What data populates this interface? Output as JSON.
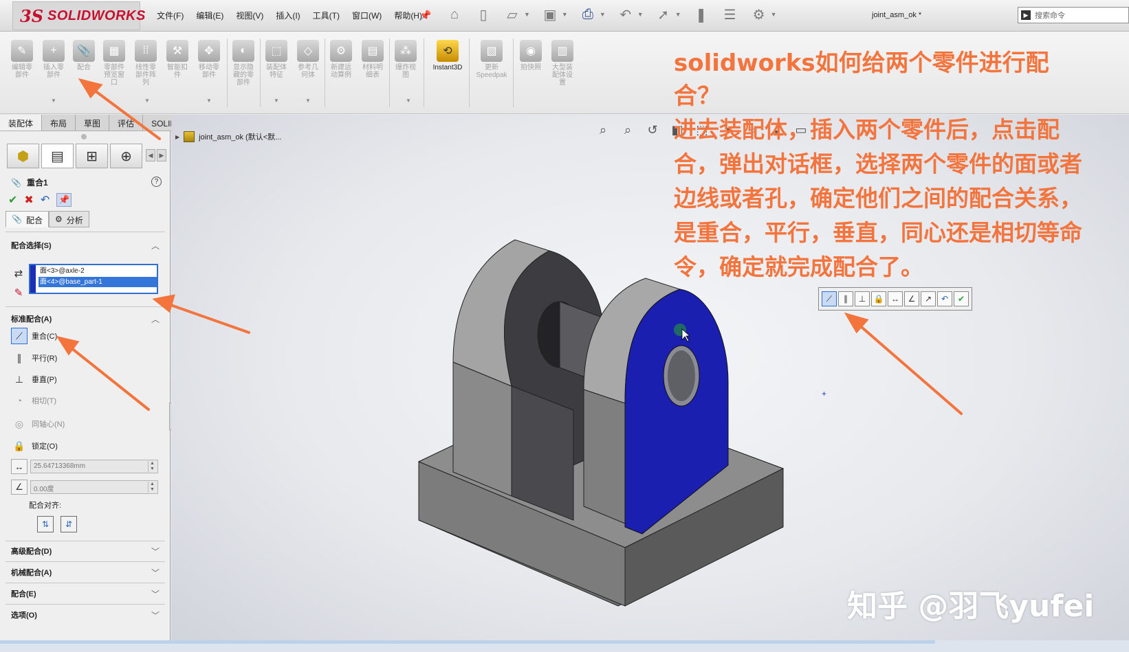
{
  "app": {
    "logo_mark": "3S",
    "logo_text": "SOLIDWORKS",
    "document_title": "joint_asm_ok *",
    "search_placeholder": "搜索命令"
  },
  "menu": [
    "文件(F)",
    "编辑(E)",
    "视图(V)",
    "插入(I)",
    "工具(T)",
    "窗口(W)",
    "帮助(H)"
  ],
  "ribbon": [
    {
      "label": "编辑零\n部件",
      "icon": "edit-component-icon"
    },
    {
      "label": "插入零\n部件",
      "icon": "insert-component-icon"
    },
    {
      "label": "配合",
      "icon": "mate-icon"
    },
    {
      "label": "零部件\n预览窗\n口",
      "icon": "component-preview-icon"
    },
    {
      "label": "线性零\n部件阵\n列",
      "icon": "linear-pattern-icon"
    },
    {
      "label": "智能扣\n件",
      "icon": "smart-fasteners-icon"
    },
    {
      "label": "移动零\n部件",
      "icon": "move-component-icon"
    },
    {
      "label": "显示隐\n藏的零\n部件",
      "icon": "show-hidden-icon"
    },
    {
      "label": "装配体\n特征",
      "icon": "assembly-features-icon"
    },
    {
      "label": "参考几\n何体",
      "icon": "reference-geometry-icon"
    },
    {
      "label": "新建运\n动算例",
      "icon": "new-motion-study-icon"
    },
    {
      "label": "材料明\n细表",
      "icon": "bom-icon"
    },
    {
      "label": "爆炸视\n图",
      "icon": "exploded-view-icon"
    },
    {
      "label": "Instant3D",
      "icon": "instant3d-icon"
    },
    {
      "label": "更新\nSpeedpak",
      "icon": "speedpak-icon"
    },
    {
      "label": "拍快照",
      "icon": "snapshot-icon"
    },
    {
      "label": "大型装\n配体设\n置",
      "icon": "large-assembly-icon"
    }
  ],
  "tabs": [
    "装配体",
    "布局",
    "草图",
    "评估",
    "SOLIDWORKS 插件"
  ],
  "property_manager": {
    "title": "重合1",
    "help": "?",
    "subtab_mates": "配合",
    "subtab_analysis": "分析",
    "section_mate_selections": "配合选择(S)",
    "selections": [
      "面<3>@axle-2",
      "面<4>@base_part-1"
    ],
    "section_standard": "标准配合(A)",
    "standard_mates": [
      {
        "label": "重合(C)",
        "icon": "coincident-icon",
        "state": "active"
      },
      {
        "label": "平行(R)",
        "icon": "parallel-icon",
        "state": "enabled"
      },
      {
        "label": "垂直(P)",
        "icon": "perpendicular-icon",
        "state": "enabled"
      },
      {
        "label": "相切(T)",
        "icon": "tangent-icon",
        "state": "disabled"
      },
      {
        "label": "同轴心(N)",
        "icon": "concentric-icon",
        "state": "disabled"
      },
      {
        "label": "锁定(O)",
        "icon": "lock-icon",
        "state": "enabled"
      }
    ],
    "distance_value": "25.64713368mm",
    "angle_value": "0.00度",
    "mate_alignment_label": "配合对齐:",
    "section_advanced": "高级配合(D)",
    "section_mechanical": "机械配合(A)",
    "section_mates": "配合(E)",
    "section_options": "选项(O)"
  },
  "viewport": {
    "tree_root": "joint_asm_ok  (默认<默..."
  },
  "annotation": {
    "title": "solidworks如何给两个零件进行配合？",
    "body": "进去装配体，插入两个零件后，点击配合，弹出对话框，选择两个零件的面或者边线或者孔，确定他们之间的配合关系，是重合，平行，垂直，同心还是相切等命令，确定就完成配合了。"
  },
  "watermark": "知乎 @羽飞yufei",
  "colors": {
    "annotation": "#f3743d",
    "selected_face": "#1b1fb0",
    "selection_highlight": "#3475d9",
    "logo_red": "#c8102e"
  }
}
